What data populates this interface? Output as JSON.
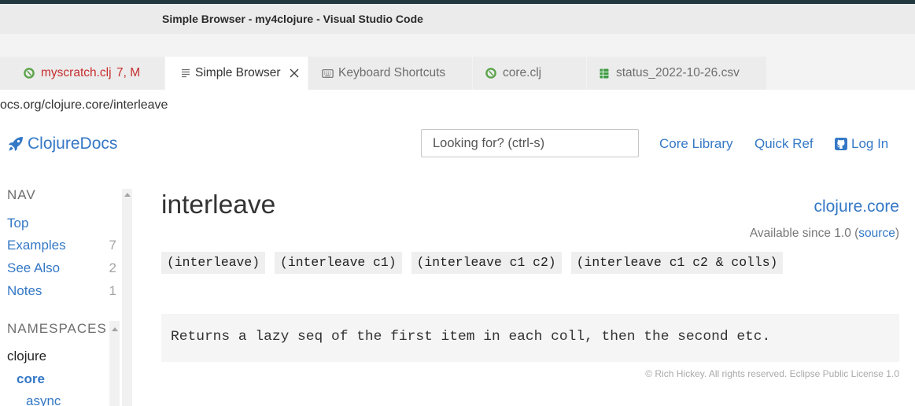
{
  "window": {
    "title": "Simple Browser - my4clojure - Visual Studio Code"
  },
  "tabs": [
    {
      "label": "myscratch.clj",
      "decoration": "7, M",
      "icon": "clojure-file-icon",
      "active": false,
      "has_problems": true
    },
    {
      "label": "Simple Browser",
      "icon": "preview-icon",
      "active": true,
      "close_icon": "close-icon"
    },
    {
      "label": "Keyboard Shortcuts",
      "icon": "keyboard-icon",
      "active": false
    },
    {
      "label": "core.clj",
      "icon": "clojure-file-icon",
      "active": false
    },
    {
      "label": "status_2022-10-26.csv",
      "icon": "csv-table-icon",
      "active": false
    }
  ],
  "address_bar": {
    "url": "ocs.org/clojure.core/interleave"
  },
  "site": {
    "logo": {
      "icon": "rocket-icon",
      "text": "ClojureDocs"
    },
    "search": {
      "placeholder": "Looking for? (ctrl-s)",
      "value": ""
    },
    "nav_links": [
      {
        "label": "Core Library"
      },
      {
        "label": "Quick Ref"
      },
      {
        "label": "Log In",
        "icon": "github-icon"
      }
    ]
  },
  "sidebar": {
    "nav": {
      "heading": "NAV",
      "items": [
        {
          "label": "Top"
        },
        {
          "label": "Examples",
          "count": "7"
        },
        {
          "label": "See Also",
          "count": "2"
        },
        {
          "label": "Notes",
          "count": "1"
        }
      ]
    },
    "namespaces": {
      "heading": "NAMESPACES",
      "group": "clojure",
      "items": [
        {
          "label": "core",
          "selected": true
        },
        {
          "label": "async",
          "selected": false
        }
      ]
    }
  },
  "main": {
    "title": "interleave",
    "namespace": "clojure.core",
    "available_since": {
      "prefix": "Available since 1.0 (",
      "link": "source",
      "suffix": ")"
    },
    "signatures": [
      "(interleave)",
      "(interleave c1)",
      "(interleave c1 c2)",
      "(interleave c1 c2 & colls)"
    ],
    "docstring": "Returns a lazy seq of the first item in each coll, then the second etc.",
    "footer": "© Rich Hickey. All rights reserved. Eclipse Public License 1.0"
  },
  "colors": {
    "link": "#3478c6",
    "text": "#333333",
    "muted": "#777777",
    "tab_problem": "#c72e2e",
    "clojure_icon": "#5ba44a",
    "csv_icon": "#3f9b45",
    "code_background": "#efefef",
    "doc_background": "#f5f5f5"
  }
}
